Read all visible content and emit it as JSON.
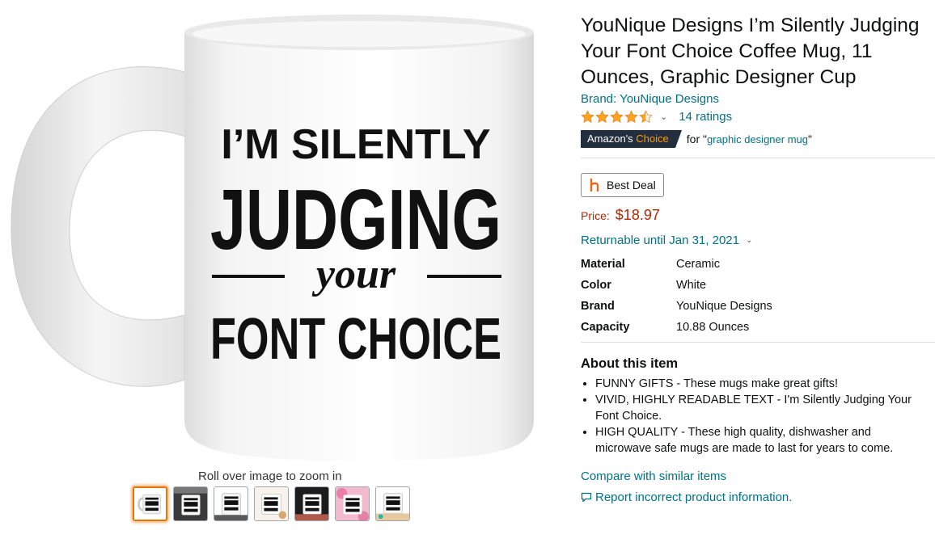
{
  "product": {
    "title": "YouNique Designs I’m Silently Judging Your Font Choice Coffee Mug, 11 Ounces, Graphic Designer Cup",
    "brand_link": "Brand: YouNique Designs",
    "rating_value": 4.5,
    "ratings_count_label": "14 ratings",
    "amazons_choice": {
      "prefix": "Amazon's",
      "suffix": "Choice",
      "for_text": "for \"",
      "keyword": "graphic designer mug",
      "close_quote": "\""
    },
    "deal_button_label": "Best Deal",
    "price_label": "Price:",
    "price_value": "$18.97",
    "returns_label": "Returnable until Jan 31, 2021",
    "specs": [
      {
        "key": "Material",
        "value": "Ceramic"
      },
      {
        "key": "Color",
        "value": "White"
      },
      {
        "key": "Brand",
        "value": "YouNique Designs"
      },
      {
        "key": "Capacity",
        "value": "10.88 Ounces"
      }
    ],
    "about_heading": "About this item",
    "bullets": [
      "FUNNY GIFTS - These mugs make great gifts!",
      "VIVID, HIGHLY READABLE TEXT - I'm Silently Judging Your Font Choice.",
      "HIGH QUALITY - These high quality, dishwasher and microwave safe mugs are made to last for years to come."
    ],
    "compare_link": "Compare with similar items",
    "report_link": "Report incorrect product information."
  },
  "image": {
    "mug_text": {
      "line1": "I’M SILENTLY",
      "line2": "JUDGING",
      "line3": "your",
      "line4": "FONT CHOICE"
    },
    "zoom_hint": "Roll over image to zoom in",
    "thumbnails": [
      {
        "style": "mug-white"
      },
      {
        "style": "mug-dark"
      },
      {
        "style": "mug-white"
      },
      {
        "style": "mug-white"
      },
      {
        "style": "mug-dark"
      },
      {
        "style": "mug-pink"
      },
      {
        "style": "mug-white"
      }
    ]
  },
  "colors": {
    "link": "#007185",
    "price": "#b12704",
    "star": "#ffa41c",
    "choice_bg": "#232f3e",
    "choice_accent": "#ff9900",
    "thumb_active": "#e77600"
  }
}
